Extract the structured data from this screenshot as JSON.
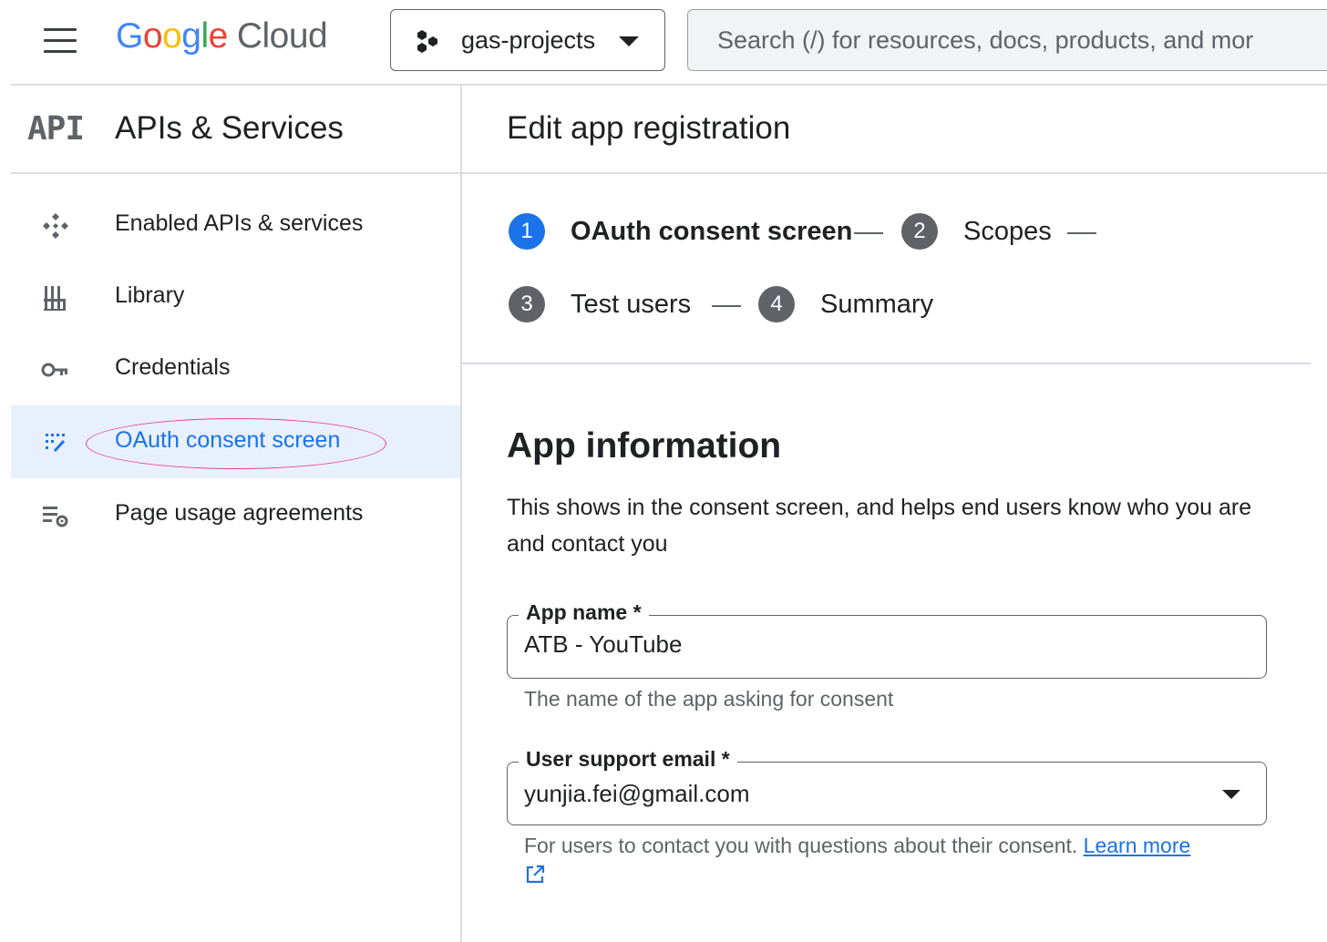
{
  "header": {
    "logo": {
      "letters": [
        "G",
        "o",
        "o",
        "g",
        "l",
        "e"
      ],
      "product": "Cloud"
    },
    "project": {
      "name": "gas-projects"
    },
    "search": {
      "placeholder": "Search (/) for resources, docs, products, and mor"
    }
  },
  "sidebar": {
    "section_logo": "API",
    "title": "APIs & Services",
    "items": [
      {
        "label": "Enabled APIs & services",
        "icon": "apis-diamond-icon",
        "active": false
      },
      {
        "label": "Library",
        "icon": "library-icon",
        "active": false
      },
      {
        "label": "Credentials",
        "icon": "key-icon",
        "active": false
      },
      {
        "label": "OAuth consent screen",
        "icon": "oauth-grid-icon",
        "active": true
      },
      {
        "label": "Page usage agreements",
        "icon": "settings-list-icon",
        "active": false
      }
    ]
  },
  "main": {
    "title": "Edit app registration",
    "steps": [
      {
        "number": "1",
        "label": "OAuth consent screen",
        "current": true
      },
      {
        "number": "2",
        "label": "Scopes",
        "current": false
      },
      {
        "number": "3",
        "label": "Test users",
        "current": false
      },
      {
        "number": "4",
        "label": "Summary",
        "current": false
      }
    ],
    "section": {
      "title": "App information",
      "description": "This shows in the consent screen, and helps end users know who you are and contact you"
    },
    "fields": {
      "app_name": {
        "label": "App name *",
        "value": "ATB - YouTube",
        "hint": "The name of the app asking for consent"
      },
      "support_email": {
        "label": "User support email *",
        "value": "yunjia.fei@gmail.com",
        "hint": "For users to contact you with questions about their consent.",
        "link": "Learn more"
      }
    }
  },
  "colors": {
    "accent": "#1a73e8",
    "active_bg": "#e8f0fe",
    "highlight": "#e8408c",
    "step_inactive": "#5f6368"
  }
}
